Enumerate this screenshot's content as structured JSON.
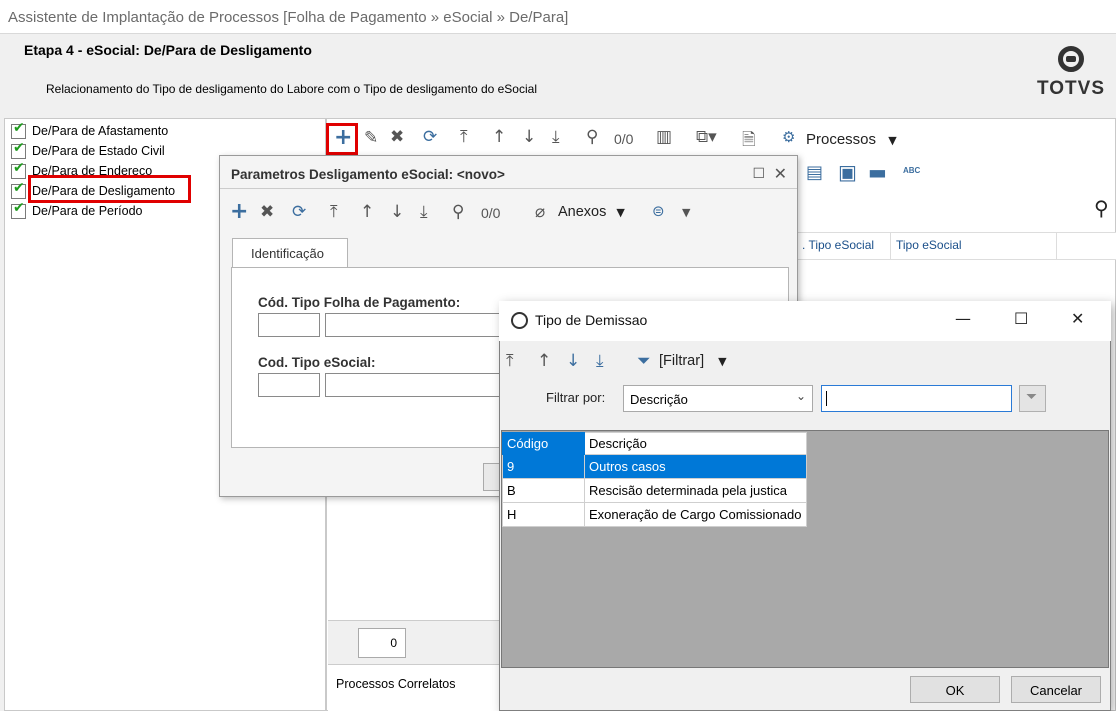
{
  "window": {
    "title": "Assistente de Implantação de Processos [Folha de Pagamento » eSocial » De/Para]"
  },
  "header": {
    "step_title": "Etapa 4 - eSocial: De/Para de Desligamento",
    "description": "Relacionamento do Tipo de desligamento do Labore com o Tipo de desligamento do eSocial",
    "logo_text": "TOTVS"
  },
  "tree": {
    "items": [
      {
        "label": "De/Para de Afastamento"
      },
      {
        "label": "De/Para de Estado Civil"
      },
      {
        "label": "De/Para de Endereco"
      },
      {
        "label": "De/Para de Desligamento"
      },
      {
        "label": "De/Para de Período"
      }
    ]
  },
  "main": {
    "toolbar": {
      "counter": "0/0",
      "processos_label": "Processos"
    },
    "grid_headers": [
      ". Tipo eSocial",
      "Tipo eSocial"
    ],
    "record_count": "0",
    "related_label": "Processos Correlatos"
  },
  "param_dialog": {
    "title": "Parametros Desligamento eSocial: <novo>",
    "counter": "0/0",
    "anexos_label": "Anexos",
    "tab_label": "Identificação",
    "field1_label": "Cód. Tipo Folha de Pagamento:",
    "field2_label": "Cod. Tipo eSocial:"
  },
  "lookup_dialog": {
    "title": "Tipo de Demissao",
    "filter_button": "[Filtrar]",
    "filter_by_label": "Filtrar por:",
    "filter_by_value": "Descrição",
    "filter_text": "",
    "columns": [
      "Código",
      "Descrição"
    ],
    "rows": [
      {
        "code": "9",
        "description": "Outros casos"
      },
      {
        "code": "B",
        "description": "Rescisão determinada pela justica"
      },
      {
        "code": "H",
        "description": "Exoneração de Cargo Comissionado"
      }
    ],
    "ok_label": "OK",
    "cancel_label": "Cancelar"
  },
  "colors": {
    "highlight_red": "#e00000",
    "selection_blue": "#0078d7",
    "toolbar_blue": "#3c6e9f"
  }
}
